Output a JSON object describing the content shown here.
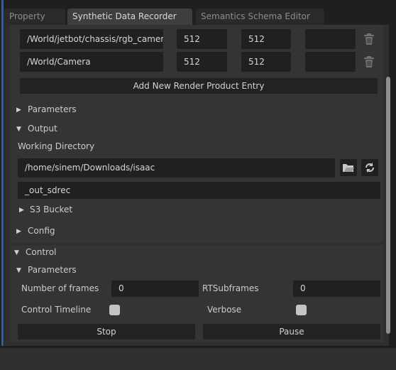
{
  "tabs": [
    {
      "label": "Property",
      "active": false
    },
    {
      "label": "Synthetic Data Recorder",
      "active": true
    },
    {
      "label": "Semantics Schema Editor",
      "active": false
    }
  ],
  "render_products": [
    {
      "path": "/World/jetbot/chassis/rgb_camera",
      "width": "512",
      "height": "512",
      "extra": ""
    },
    {
      "path": "/World/Camera",
      "width": "512",
      "height": "512",
      "extra": ""
    }
  ],
  "add_render_product_label": "Add New Render Product Entry",
  "sections": {
    "parameters": "Parameters",
    "output": "Output",
    "working_directory_label": "Working Directory",
    "working_directory_value": "/home/sinem/Downloads/isaac",
    "output_folder_value": "_out_sdrec",
    "s3_bucket": "S3 Bucket",
    "config": "Config"
  },
  "control": {
    "title": "Control",
    "parameters": "Parameters",
    "num_frames_label": "Number of frames",
    "num_frames_value": "0",
    "rt_subframes_label": "RTSubframes",
    "rt_subframes_value": "0",
    "control_timeline_label": "Control Timeline",
    "control_timeline_checked": false,
    "verbose_label": "Verbose",
    "verbose_checked": false,
    "stop_label": "Stop",
    "pause_label": "Pause"
  },
  "colors": {
    "background": "#2b2b2b",
    "panel": "#343434",
    "field": "#202020",
    "accent_strip": "#2f5f9e"
  },
  "icons": {
    "delete": "trash-icon",
    "folder": "folder-icon",
    "refresh": "refresh-icon",
    "expand": "triangle-right-icon",
    "collapse": "triangle-down-icon"
  }
}
